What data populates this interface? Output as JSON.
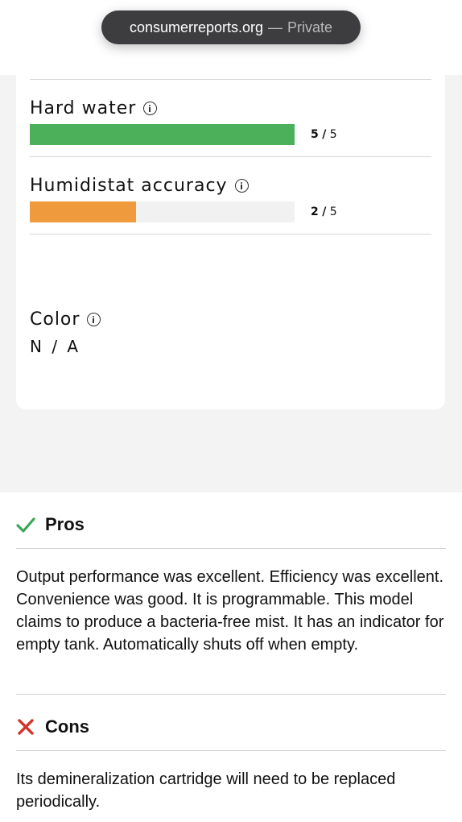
{
  "browser": {
    "url": "consumerreports.org",
    "separator": "—",
    "mode": "Private"
  },
  "ratings": [
    {
      "label": "Hard water",
      "score": "5",
      "max": "5",
      "fraction": 1.0,
      "color": "#4caf5a"
    },
    {
      "label": "Humidistat accuracy",
      "score": "2",
      "max": "5",
      "fraction": 0.4,
      "color": "#f09a3e"
    }
  ],
  "score_separator": "/",
  "color_field": {
    "label": "Color",
    "value": "N / A"
  },
  "pros": {
    "title": "Pros",
    "text": "Output performance was excellent. Efficiency was excellent. Convenience was good. It is programmable. This model claims to produce a bacteria-free mist. It has an indicator for empty tank. Automatically shuts off when empty.",
    "icon": "check-icon",
    "icon_color": "#3aa657"
  },
  "cons": {
    "title": "Cons",
    "text": "Its demineralization cartridge will need to be replaced periodically.",
    "icon": "x-icon",
    "icon_color": "#d7332c"
  }
}
